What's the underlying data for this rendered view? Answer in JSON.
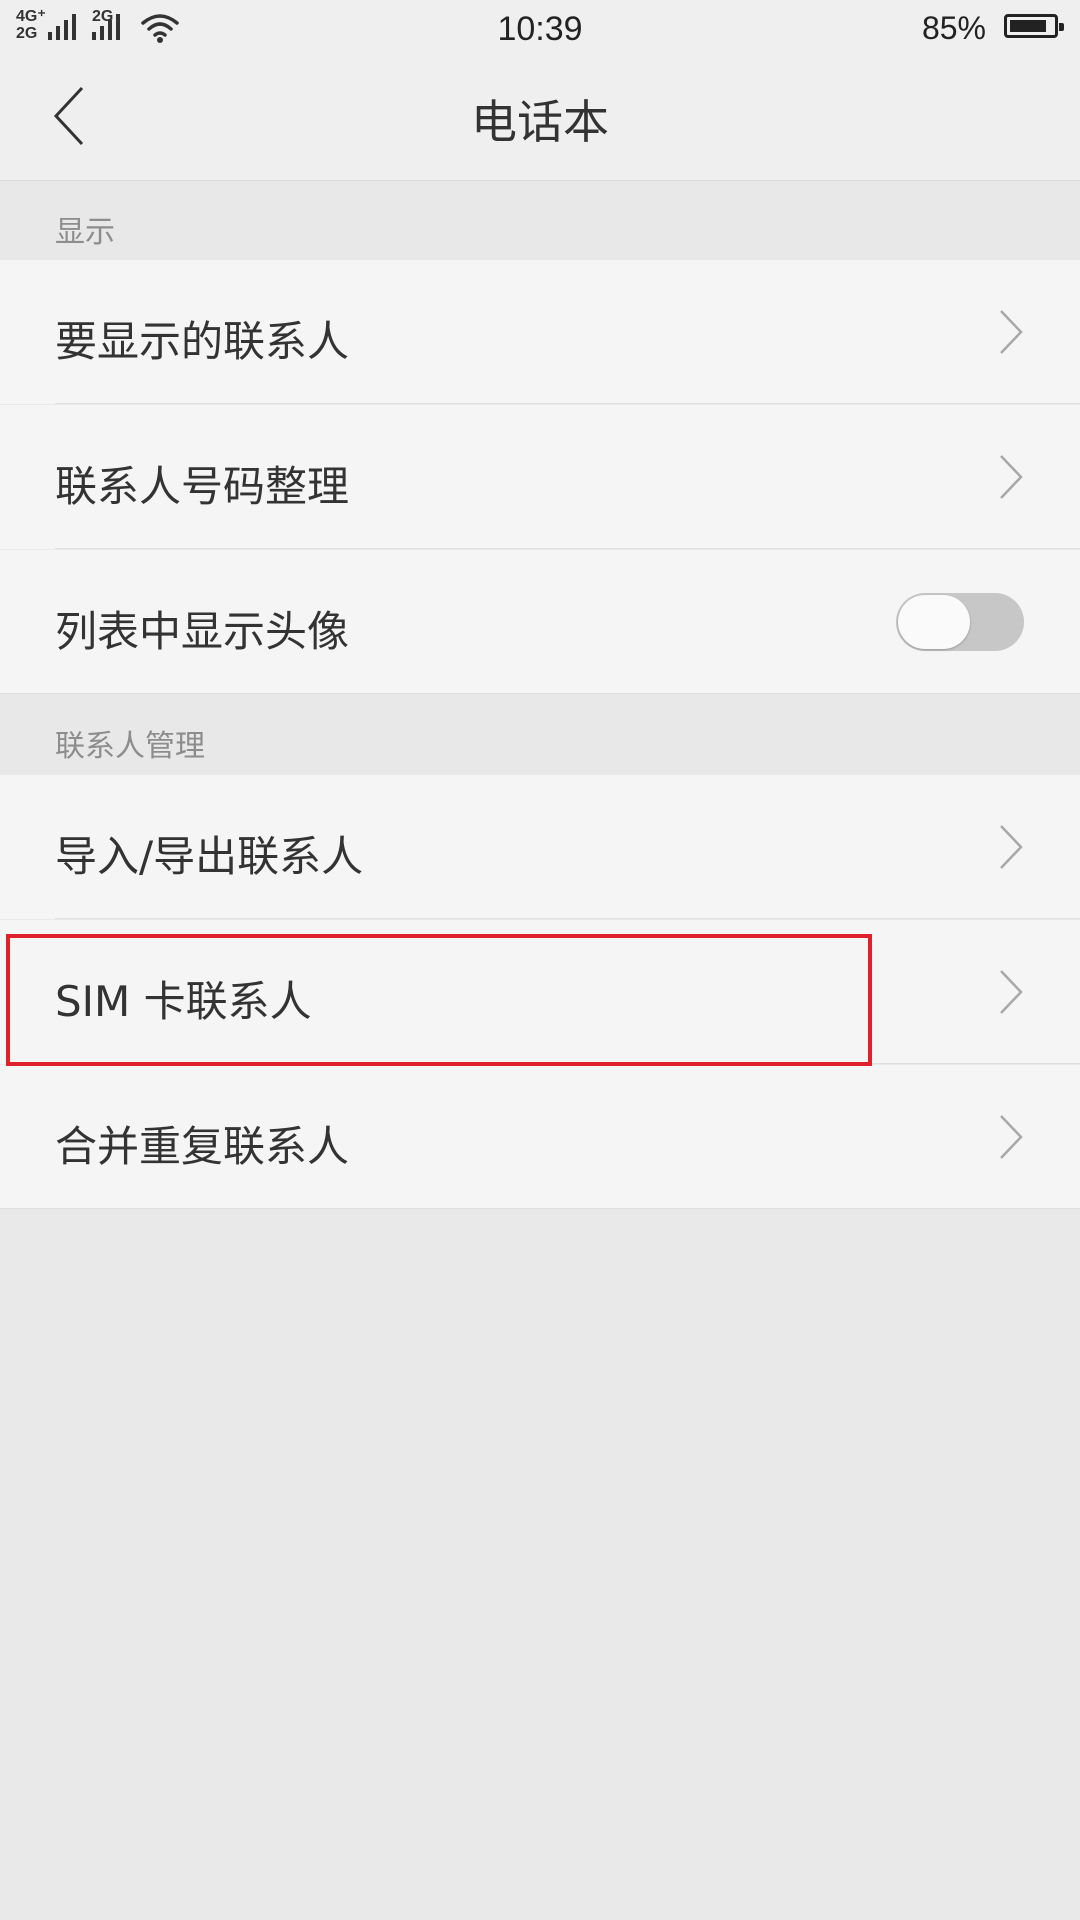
{
  "status_bar": {
    "network_1": "4G⁺",
    "network_2": "2G",
    "network_3": "2G",
    "time": "10:39",
    "battery": "85%",
    "battery_level": 0.85,
    "icons": [
      "signal-icon",
      "wifi-icon",
      "battery-icon"
    ]
  },
  "header": {
    "title": "电话本",
    "back_icon": "chevron-left-icon"
  },
  "sections": [
    {
      "header": "显示",
      "items": [
        {
          "label": "要显示的联系人",
          "control": "chevron-right-icon"
        },
        {
          "label": "联系人号码整理",
          "control": "chevron-right-icon"
        },
        {
          "label": "列表中显示头像",
          "control": "toggle",
          "toggle_on": false
        }
      ]
    },
    {
      "header": "联系人管理",
      "items": [
        {
          "label": "导入/导出联系人",
          "control": "chevron-right-icon"
        },
        {
          "label": "SIM 卡联系人",
          "control": "chevron-right-icon",
          "highlighted": true
        },
        {
          "label": "合并重复联系人",
          "control": "chevron-right-icon"
        }
      ]
    }
  ],
  "colors": {
    "highlight": "#e0202a",
    "toggle_track": "#c7c7c7",
    "background": "#e9e9e9",
    "row_background": "#f5f5f5"
  }
}
